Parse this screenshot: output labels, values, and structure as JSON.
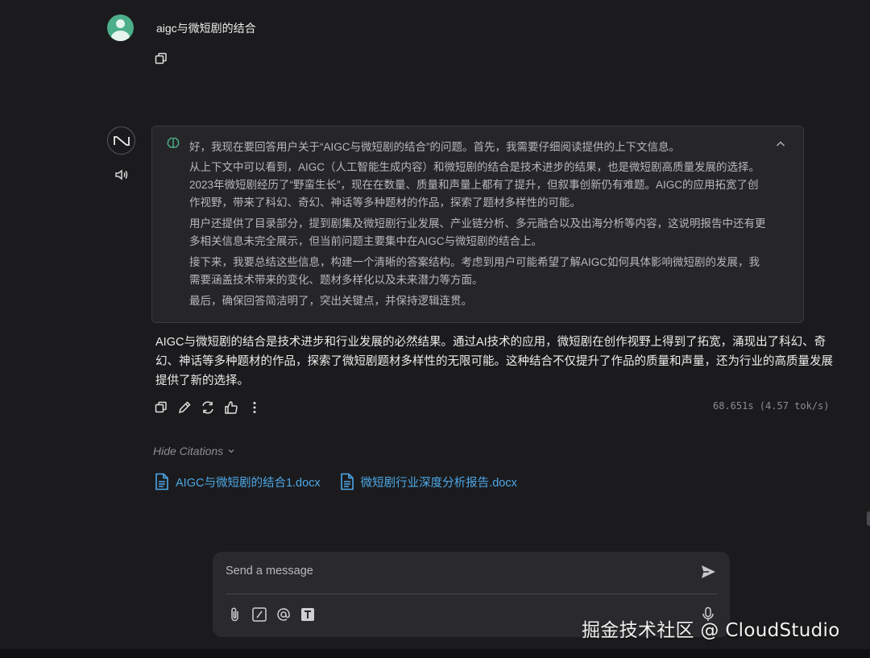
{
  "user_message": {
    "text": "aigc与微短剧的结合"
  },
  "assistant": {
    "thinking": {
      "paragraphs": [
        "好，我现在要回答用户关于“AIGC与微短剧的结合”的问题。首先，我需要仔细阅读提供的上下文信息。",
        "从上下文中可以看到，AIGC（人工智能生成内容）和微短剧的结合是技术进步的结果，也是微短剧高质量发展的选择。2023年微短剧经历了“野蛮生长”，现在在数量、质量和声量上都有了提升，但叙事创新仍有难题。AIGC的应用拓宽了创作视野，带来了科幻、奇幻、神话等多种题材的作品，探索了题材多样性的可能。",
        "用户还提供了目录部分，提到剧集及微短剧行业发展、产业链分析、多元融合以及出海分析等内容，这说明报告中还有更多相关信息未完全展示，但当前问题主要集中在AIGC与微短剧的结合上。",
        "接下来，我要总结这些信息，构建一个清晰的答案结构。考虑到用户可能希望了解AIGC如何具体影响微短剧的发展，我需要涵盖技术带来的变化、题材多样化以及未来潜力等方面。",
        "最后，确保回答简洁明了，突出关键点，并保持逻辑连贯。"
      ]
    },
    "answer": "AIGC与微短剧的结合是技术进步和行业发展的必然结果。通过AI技术的应用，微短剧在创作视野上得到了拓宽，涌现出了科幻、奇幻、神话等多种题材的作品，探索了微短剧题材多样性的无限可能。这种结合不仅提升了作品的质量和声量，还为行业的高质量发展提供了新的选择。",
    "timing": "68.651s (4.57 tok/s)",
    "hide_citations_label": "Hide Citations",
    "citations": [
      "AIGC与微短剧的结合1.docx",
      "微短剧行业深度分析报告.docx"
    ]
  },
  "composer": {
    "placeholder": "Send a message"
  },
  "watermark": "掘金技术社区 @ CloudStudio",
  "colors": {
    "background": "#1b1b1d",
    "accent_link": "#4da8e8",
    "avatar_green": "#4caf8a"
  }
}
